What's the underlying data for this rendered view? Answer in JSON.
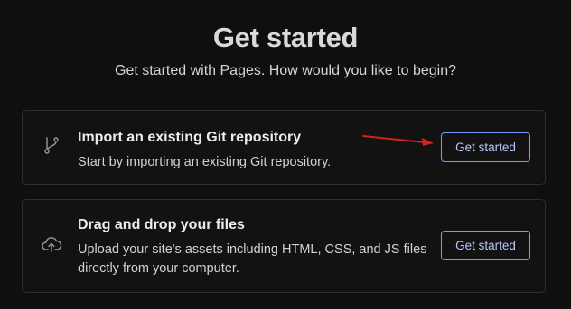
{
  "header": {
    "title": "Get started",
    "subtitle": "Get started with Pages. How would you like to begin?"
  },
  "options": [
    {
      "icon": "git-branch-icon",
      "title": "Import an existing Git repository",
      "description": "Start by importing an existing Git repository.",
      "button_label": "Get started"
    },
    {
      "icon": "cloud-upload-icon",
      "title": "Drag and drop your files",
      "description": "Upload your site's assets including HTML, CSS, and JS files directly from your computer.",
      "button_label": "Get started"
    }
  ],
  "annotation": {
    "icon": "red-arrow-icon",
    "color": "#d62020"
  },
  "colors": {
    "background": "#0f0f0f",
    "card_border": "#2f2f2f",
    "button_border": "#7a9cff",
    "button_text": "#b7c9ff"
  }
}
